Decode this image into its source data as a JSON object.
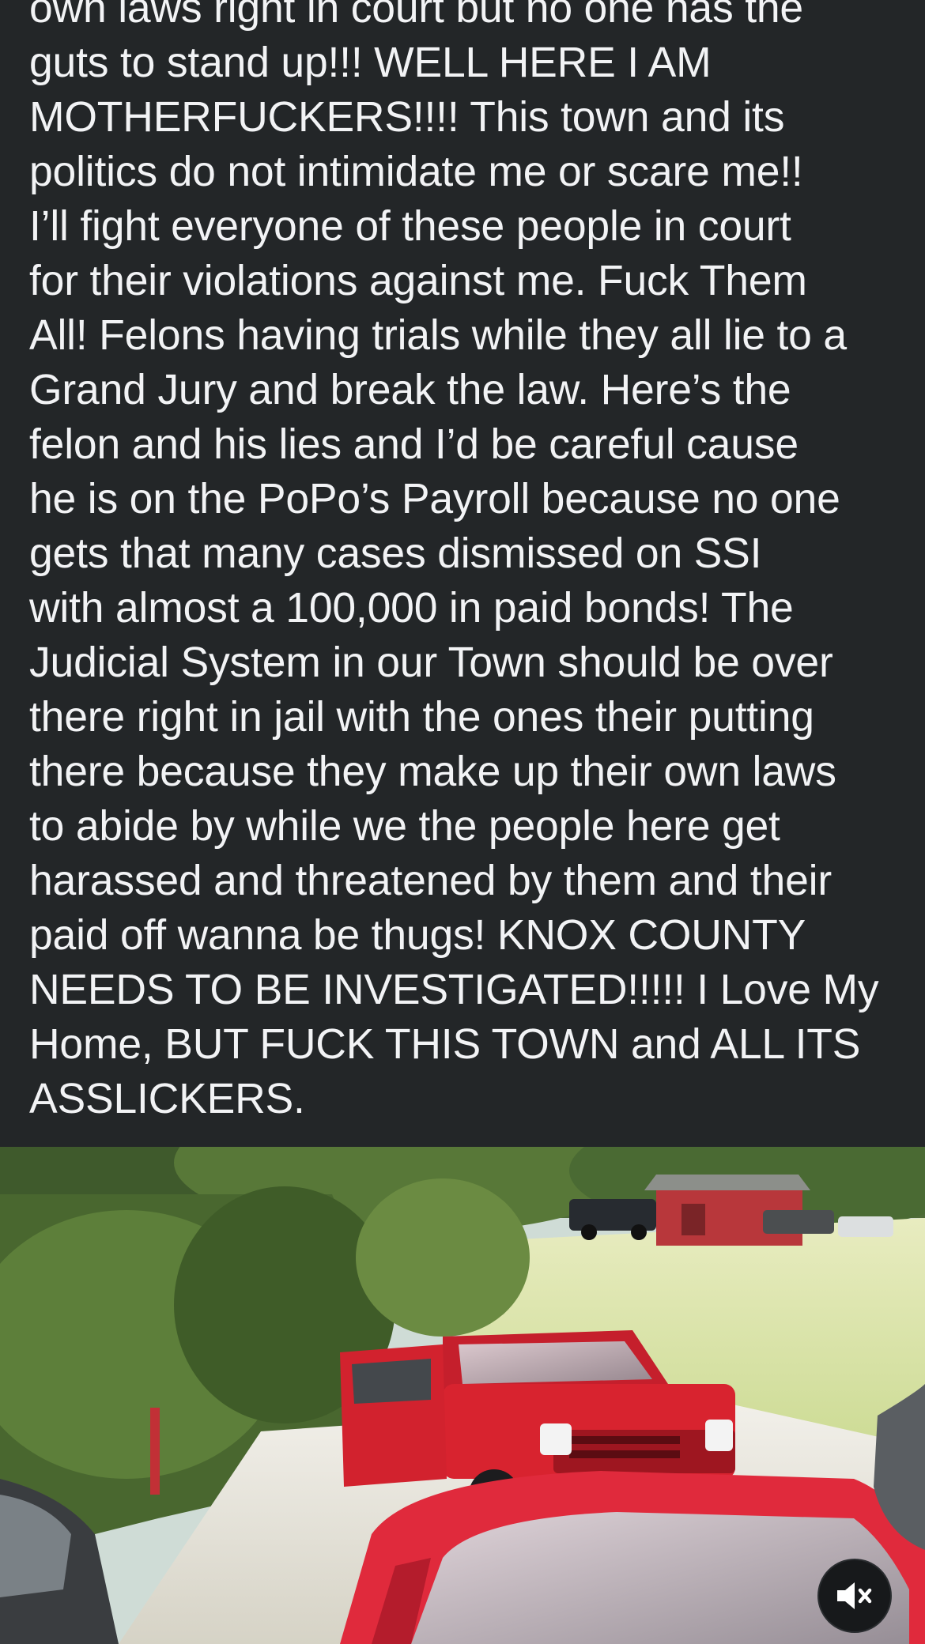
{
  "post": {
    "text": "own laws right in court but no one has the\nguts to stand up!!! WELL HERE I AM\nMOTHERFUCKERS!!!! This town and its\npolitics do not intimidate me or scare me!!\nI’ll fight everyone of these people in court\nfor their violations against me. Fuck Them\nAll! Felons having trials while they all lie to a\nGrand Jury and break the law. Here’s the\nfelon and his lies and I’d be careful cause\nhe is on the PoPo’s Payroll because no one\ngets that many cases dismissed on SSI\nwith almost a 100,000 in paid bonds! The\nJudicial System in our Town should be over\nthere right in jail with the ones their putting\nthere because they make up their own laws\nto abide by while we the people here get\nharassed and threatened by them and their\npaid off wanna be thugs! KNOX COUNTY\nNEEDS TO BE INVESTIGATED!!!!! I Love My\nHome, BUT FUCK THIS TOWN and ALL ITS\nASSLICKERS."
  },
  "video": {
    "muted": true,
    "mute_icon": "speaker-muted-icon"
  },
  "colors": {
    "background": "#232628",
    "text": "#f2f3f5",
    "truck_red": "#d8232f",
    "car_red": "#e02a3c"
  }
}
